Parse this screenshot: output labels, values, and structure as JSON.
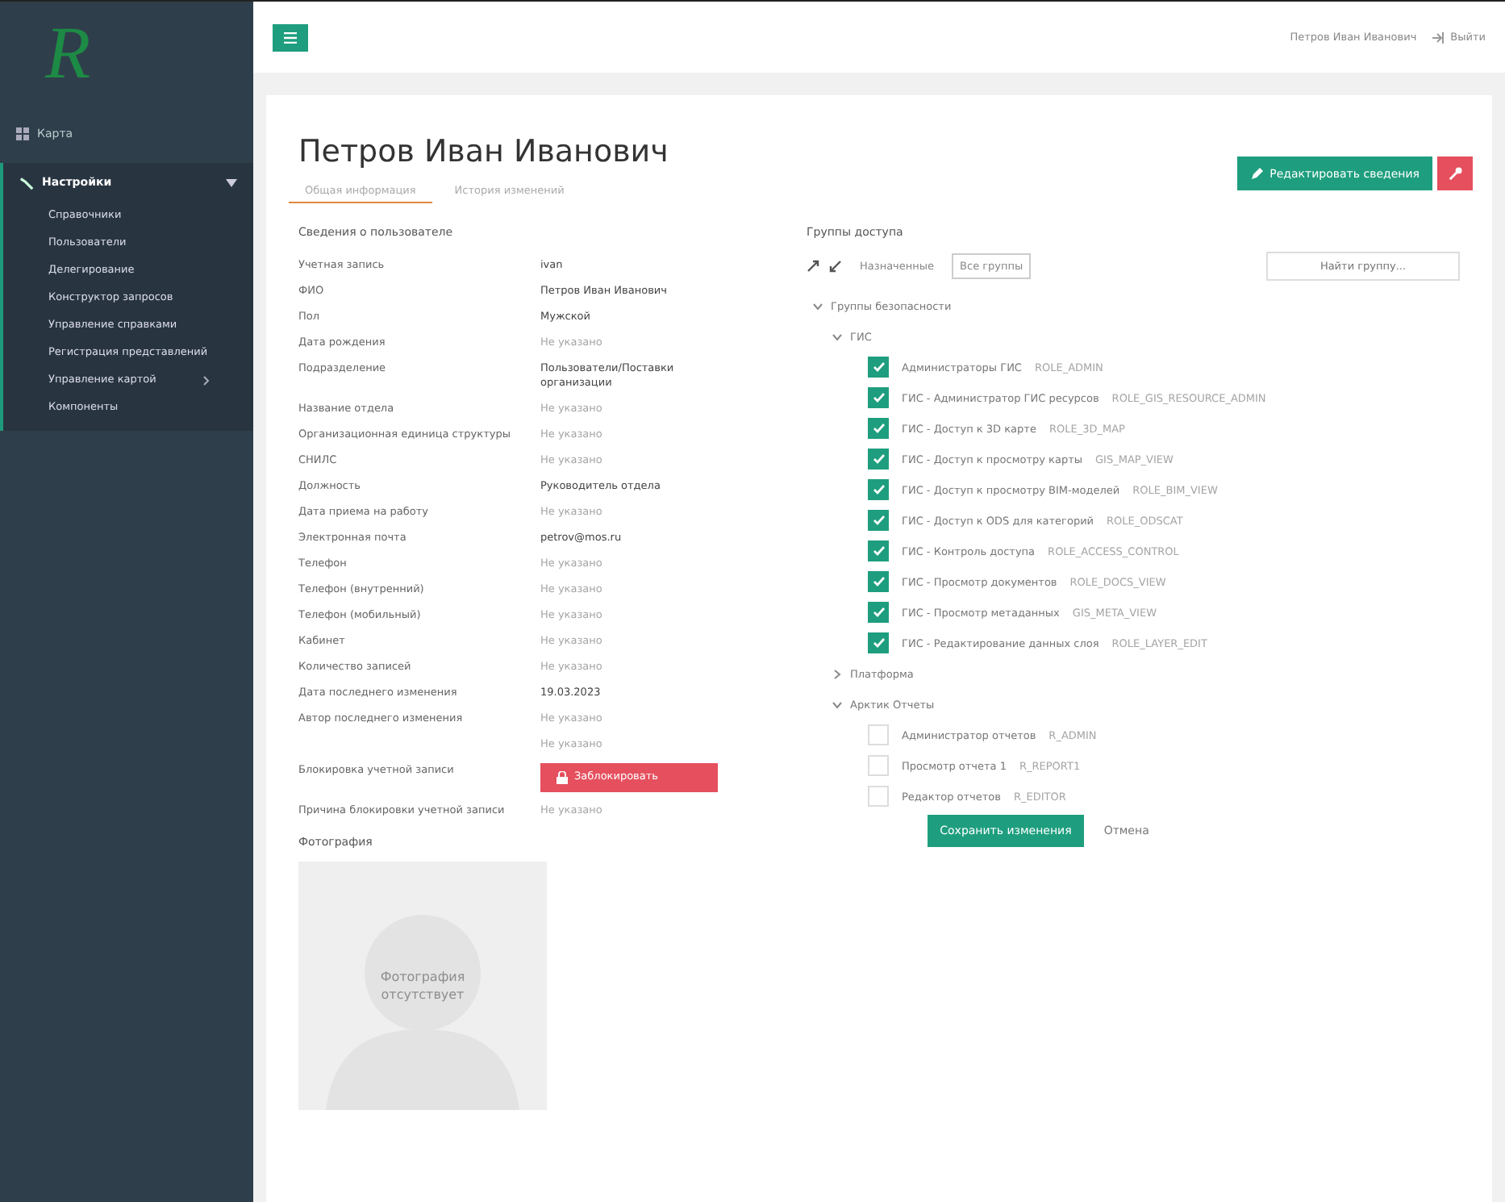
{
  "logo": "R",
  "sidebar": {
    "items": [
      {
        "label": "Карта",
        "expanded": false,
        "selected": false
      },
      {
        "label": "Настройки",
        "expanded": true,
        "selected": true,
        "children": [
          {
            "label": "Справочники",
            "has_arrow": false
          },
          {
            "label": "Пользователи",
            "has_arrow": false
          },
          {
            "label": "Делегирование",
            "has_arrow": false
          },
          {
            "label": "Конструктор запросов",
            "has_arrow": false
          },
          {
            "label": "Управление справками",
            "has_arrow": false
          },
          {
            "label": "Регистрация представлений",
            "has_arrow": false
          },
          {
            "label": "Управление картой",
            "has_arrow": true
          },
          {
            "label": "Компоненты",
            "has_arrow": false
          }
        ]
      }
    ]
  },
  "topbar": {
    "user": "Петров Иван Иванович",
    "logout": "Выйти"
  },
  "page": {
    "title": "Петров Иван Иванович",
    "tabs": [
      {
        "label": "Общая информация",
        "selected": true
      },
      {
        "label": "История изменений",
        "selected": false
      }
    ],
    "edit_button": "Редактировать сведения"
  },
  "user_info": {
    "heading": "Сведения о пользователе",
    "fields": [
      {
        "label": "Учетная запись",
        "kind": "text",
        "muted": false,
        "values": [
          "ivan"
        ]
      },
      {
        "label": "ФИО",
        "kind": "text",
        "muted": false,
        "values": [
          "Петров Иван Иванович"
        ]
      },
      {
        "label": "Пол",
        "kind": "text",
        "muted": false,
        "values": [
          "Мужской"
        ]
      },
      {
        "label": "Дата рождения",
        "kind": "text",
        "muted": true,
        "values": [
          "Не указано"
        ]
      },
      {
        "label": "Подразделение",
        "kind": "text",
        "muted": false,
        "values": [
          "Пользователи/Поставки организации"
        ]
      },
      {
        "label": "Название отдела",
        "kind": "text",
        "muted": true,
        "values": [
          "Не указано"
        ]
      },
      {
        "label": "Организационная единица структуры",
        "kind": "text",
        "muted": true,
        "values": [
          "Не указано"
        ]
      },
      {
        "label": "СНИЛС",
        "kind": "text",
        "muted": true,
        "values": [
          "Не указано"
        ]
      },
      {
        "label": "Должность",
        "kind": "text",
        "muted": false,
        "values": [
          "Руководитель отдела"
        ]
      },
      {
        "label": "Дата приема на работу",
        "kind": "text",
        "muted": true,
        "values": [
          "Не указано"
        ]
      },
      {
        "label": "Электронная почта",
        "kind": "text",
        "muted": false,
        "values": [
          "petrov@mos.ru"
        ]
      },
      {
        "label": "Телефон",
        "kind": "text",
        "muted": true,
        "values": [
          "Не указано"
        ]
      },
      {
        "label": "Телефон (внутренний)",
        "kind": "text",
        "muted": true,
        "values": [
          "Не указано"
        ]
      },
      {
        "label": "Телефон (мобильный)",
        "kind": "text",
        "muted": true,
        "values": [
          "Не указано"
        ]
      },
      {
        "label": "Кабинет",
        "kind": "text",
        "muted": true,
        "values": [
          "Не указано"
        ]
      },
      {
        "label": "Количество записей",
        "kind": "text",
        "muted": true,
        "values": [
          "Не указано"
        ]
      },
      {
        "label": "Дата последнего изменения",
        "kind": "text",
        "muted": false,
        "values": [
          "19.03.2023"
        ]
      },
      {
        "label": "Автор последнего изменения",
        "kind": "text",
        "muted": true,
        "values": [
          "Не указано",
          "Не указано"
        ]
      },
      {
        "label": "Блокировка учетной записи",
        "kind": "button",
        "values": [
          "Заблокировать"
        ]
      },
      {
        "label": "Причина блокировки учетной записи",
        "kind": "text",
        "muted": true,
        "values": [
          "Не указано"
        ]
      }
    ],
    "photo_heading": "Фотография",
    "photo_placeholder": "Фотография отсутствует"
  },
  "access_groups": {
    "heading": "Группы доступа",
    "filters": [
      {
        "label": "Назначенные",
        "selected": false
      },
      {
        "label": "Все группы",
        "selected": true
      }
    ],
    "search": {
      "placeholder": "Найти группу..."
    },
    "tree": [
      {
        "kind": "folder",
        "label": "Группы безопасности",
        "expanded": true,
        "children": [
          {
            "kind": "folder",
            "label": "ГИС",
            "expanded": true,
            "children": [
              {
                "kind": "group",
                "label": "Администраторы ГИС",
                "code": "ROLE_ADMIN",
                "checked": true
              },
              {
                "kind": "group",
                "label": "ГИС - Администратор ГИС ресурсов",
                "code": "ROLE_GIS_RESOURCE_ADMIN",
                "checked": true
              },
              {
                "kind": "group",
                "label": "ГИС - Доступ к 3D карте",
                "code": "ROLE_3D_MAP",
                "checked": true
              },
              {
                "kind": "group",
                "label": "ГИС - Доступ к просмотру карты",
                "code": "GIS_MAP_VIEW",
                "checked": true
              },
              {
                "kind": "group",
                "label": "ГИС - Доступ к просмотру BIM-моделей",
                "code": "ROLE_BIM_VIEW",
                "checked": true
              },
              {
                "kind": "group",
                "label": "ГИС - Доступ к ODS для категорий",
                "code": "ROLE_ODSCAT",
                "checked": true
              },
              {
                "kind": "group",
                "label": "ГИС - Контроль доступа",
                "code": "ROLE_ACCESS_CONTROL",
                "checked": true
              },
              {
                "kind": "group",
                "label": "ГИС - Просмотр документов",
                "code": "ROLE_DOCS_VIEW",
                "checked": true
              },
              {
                "kind": "group",
                "label": "ГИС - Просмотр метаданных",
                "code": "GIS_META_VIEW",
                "checked": true
              },
              {
                "kind": "group",
                "label": "ГИС - Редактирование данных слоя",
                "code": "ROLE_LAYER_EDIT",
                "checked": true
              }
            ]
          },
          {
            "kind": "folder",
            "label": "Платформа",
            "expanded": false
          },
          {
            "kind": "folder",
            "label": "Арктик Отчеты",
            "expanded": true,
            "children": [
              {
                "kind": "group",
                "label": "Администратор отчетов",
                "code": "R_ADMIN",
                "checked": false
              },
              {
                "kind": "group",
                "label": "Просмотр отчета 1",
                "code": "R_REPORT1",
                "checked": false
              },
              {
                "kind": "group",
                "label": "Редактор отчетов",
                "code": "R_EDITOR",
                "checked": false
              }
            ]
          }
        ]
      }
    ],
    "save_button": "Сохранить изменения",
    "cancel_button": "Отмена"
  }
}
